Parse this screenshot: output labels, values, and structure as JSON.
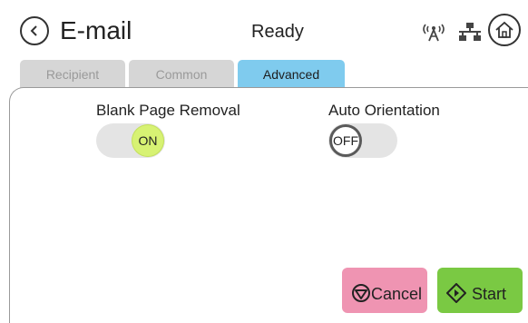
{
  "header": {
    "title": "E-mail",
    "status": "Ready",
    "icons": {
      "back": "back-arrow-icon",
      "wireless": "wireless-icon",
      "network": "network-icon",
      "home": "home-icon"
    }
  },
  "tabs": [
    {
      "label": "Recipient",
      "active": false
    },
    {
      "label": "Common",
      "active": false
    },
    {
      "label": "Advanced",
      "active": true
    }
  ],
  "settings": {
    "blank_page_removal": {
      "label": "Blank Page Removal",
      "state": "ON"
    },
    "auto_orientation": {
      "label": "Auto Orientation",
      "state": "OFF"
    }
  },
  "actions": {
    "cancel_label": "Cancel",
    "start_label": "Start"
  },
  "colors": {
    "active_tab": "#7fcbee",
    "inactive_tab": "#d6d6d6",
    "toggle_on": "#d7f273",
    "cancel": "#ef94b2",
    "start": "#7ac943"
  }
}
